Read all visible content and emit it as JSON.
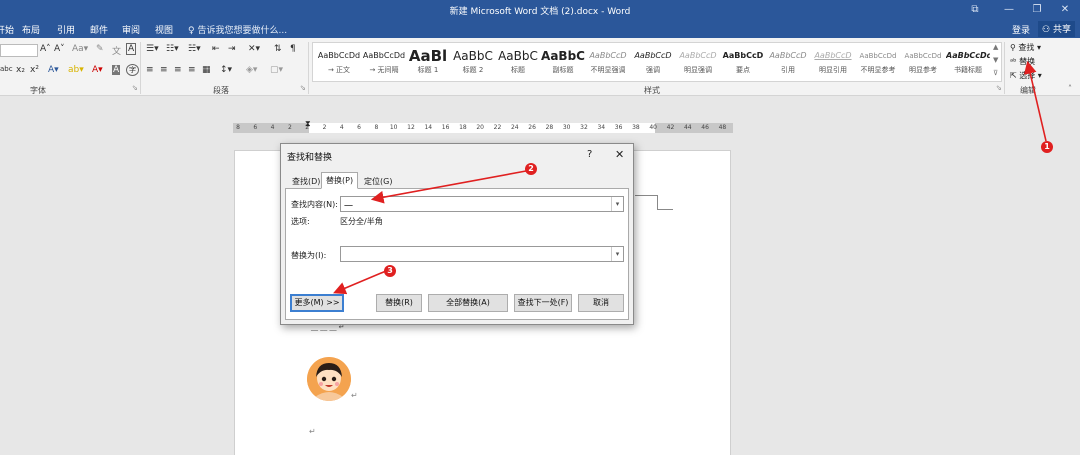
{
  "window": {
    "title": "新建 Microsoft Word 文档 (2).docx - Word",
    "controls": [
      "⧉",
      "—",
      "❐",
      "✕"
    ]
  },
  "menu": {
    "tabs": [
      "开始",
      "布局",
      "引用",
      "邮件",
      "审阅",
      "视图"
    ],
    "tell_me": "告诉我您想要做什么...",
    "login": "登录",
    "share": "共享"
  },
  "ribbon": {
    "groups": {
      "font": "字体",
      "paragraph": "段落",
      "styles": "样式",
      "editing": "编辑"
    },
    "styles": [
      {
        "sample": "AaBbCcDd",
        "name": "→ 正文"
      },
      {
        "sample": "AaBbCcDd",
        "name": "→ 无间隔"
      },
      {
        "sample": "AaBl",
        "name": "标题 1"
      },
      {
        "sample": "AaBbC",
        "name": "标题 2"
      },
      {
        "sample": "AaBbC",
        "name": "标题"
      },
      {
        "sample": "AaBbC",
        "name": "副标题"
      },
      {
        "sample": "AaBbCcD",
        "name": "不明显强调"
      },
      {
        "sample": "AaBbCcD",
        "name": "强调"
      },
      {
        "sample": "AaBbCcD",
        "name": "明显强调"
      },
      {
        "sample": "AaBbCcD",
        "name": "要点"
      },
      {
        "sample": "AaBbCcD",
        "name": "引用"
      },
      {
        "sample": "AaBbCcD",
        "name": "明显引用"
      },
      {
        "sample": "AaBbCcDd",
        "name": "不明显参考"
      },
      {
        "sample": "AaBbCcDd",
        "name": "明显参考"
      },
      {
        "sample": "AaBbCcDd",
        "name": "书籍标题"
      }
    ],
    "editing": {
      "find": "查找",
      "replace": "替换",
      "select": "选择"
    }
  },
  "ruler": {
    "ticks": [
      "8",
      "6",
      "4",
      "2",
      "2",
      "2",
      "4",
      "6",
      "8",
      "10",
      "12",
      "14",
      "16",
      "18",
      "20",
      "22",
      "24",
      "26",
      "28",
      "30",
      "32",
      "34",
      "36",
      "38",
      "40",
      "42",
      "44",
      "46",
      "48"
    ]
  },
  "dialog": {
    "title": "查找和替换",
    "help": "?",
    "close": "✕",
    "tabs": [
      "查找(D)",
      "替换(P)",
      "定位(G)"
    ],
    "find_label": "查找内容(N):",
    "find_value": "一",
    "options_label": "选项:",
    "options_value": "区分全/半角",
    "replace_label": "替换为(I):",
    "replace_value": "",
    "buttons": {
      "more": "更多(M) >>",
      "replace": "替换(R)",
      "replace_all": "全部替换(A)",
      "find_next": "查找下一处(F)",
      "cancel": "取消"
    }
  },
  "annotations": [
    "1",
    "2",
    "3"
  ],
  "colors": {
    "title_bar": "#2b579a",
    "annotation_red": "#e02020",
    "primary_button_border": "#3c7fd1"
  }
}
